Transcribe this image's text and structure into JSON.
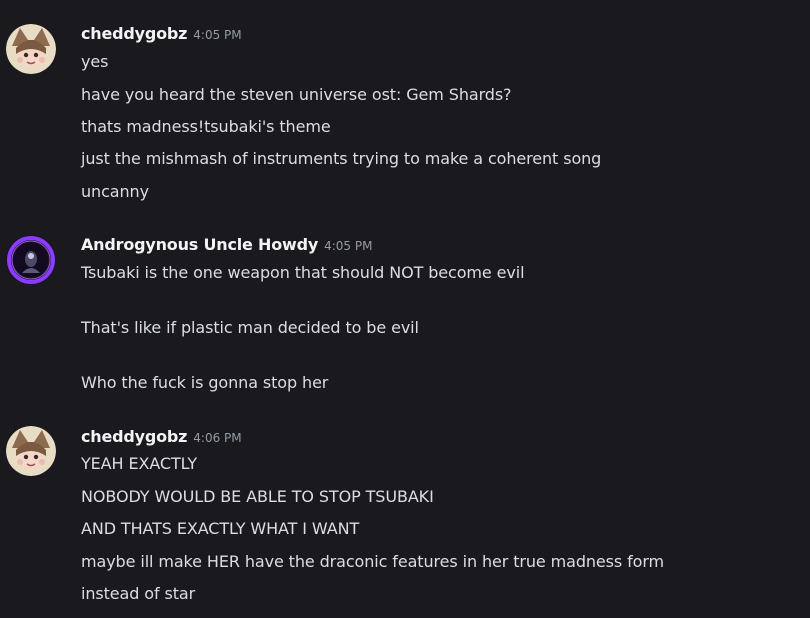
{
  "messages": [
    {
      "author": "cheddygobz",
      "time": "4:05 PM",
      "avatar_icon": "cat-girl-avatar-icon",
      "lines": [
        "yes",
        "have you heard the steven universe ost: Gem Shards?",
        "thats madness!tsubaki's theme",
        "just the mishmash of instruments trying to make a coherent song",
        "uncanny"
      ]
    },
    {
      "author": "Androgynous Uncle Howdy",
      "time": "4:05 PM",
      "avatar_icon": "purple-ring-avatar-icon",
      "lines": [
        "Tsubaki is the one weapon that should NOT become evil",
        "That's like if plastic man decided to be evil",
        "Who the fuck is gonna stop her"
      ]
    },
    {
      "author": "cheddygobz",
      "time": "4:06 PM",
      "avatar_icon": "cat-girl-avatar-icon",
      "lines": [
        "YEAH EXACTLY",
        "NOBODY WOULD BE ABLE TO STOP TSUBAKI",
        "AND THATS EXACTLY WHAT I WANT",
        "maybe ill make HER have the draconic features in her true madness form",
        "instead of star"
      ]
    }
  ],
  "colors": {
    "background": "#1a1a1e",
    "username": "#f2f3f5",
    "text": "#dbdee1",
    "timestamp": "#949ba4",
    "avatar_ring": "#8a3cff"
  }
}
